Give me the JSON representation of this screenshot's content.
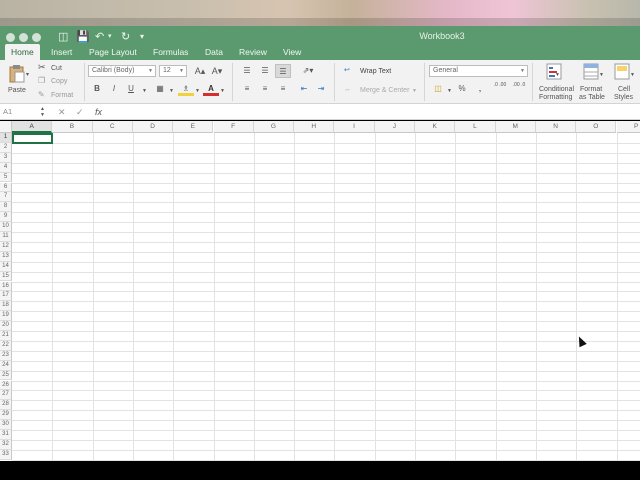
{
  "window": {
    "title": "Workbook3"
  },
  "tabs": [
    {
      "label": "Home",
      "active": true
    },
    {
      "label": "Insert"
    },
    {
      "label": "Page Layout"
    },
    {
      "label": "Formulas"
    },
    {
      "label": "Data"
    },
    {
      "label": "Review"
    },
    {
      "label": "View"
    }
  ],
  "ribbon": {
    "paste_label": "Paste",
    "cut_label": "Cut",
    "copy_label": "Copy",
    "format_label": "Format",
    "font_name": "Calibri (Body)",
    "font_size": "12",
    "bold": "B",
    "italic": "I",
    "underline": "U",
    "wrap_text": "Wrap Text",
    "merge_center": "Merge & Center",
    "number_format": "General",
    "percent": "%",
    "comma": "‚",
    "increase_decimal": ".0 .00",
    "decrease_decimal": ".00 .0",
    "conditional_formatting": [
      "Conditional",
      "Formatting"
    ],
    "format_as_table": [
      "Format",
      "as Table"
    ],
    "cell_styles": [
      "Cell",
      "Styles"
    ]
  },
  "formula_bar": {
    "name_box": "A1",
    "fx": "fx"
  },
  "grid": {
    "columns": [
      "A",
      "B",
      "C",
      "D",
      "E",
      "F",
      "G",
      "H",
      "I",
      "J",
      "K",
      "L",
      "M",
      "N",
      "O",
      "P"
    ],
    "rows": [
      "1",
      "2",
      "3",
      "4",
      "5",
      "6",
      "7",
      "8",
      "9",
      "10",
      "11",
      "12",
      "13",
      "14",
      "15",
      "16",
      "17",
      "18",
      "19",
      "20",
      "21",
      "22",
      "23",
      "24",
      "25",
      "26",
      "27",
      "28",
      "29",
      "30",
      "31",
      "32",
      "33"
    ],
    "active_cell": "A1"
  },
  "colors": {
    "accent": "#5b9a6e",
    "selection": "#217346"
  },
  "icons": [
    "new-sheet-icon",
    "save-icon",
    "undo-icon",
    "redo-icon",
    "customize-icon",
    "paste-icon",
    "cut-icon",
    "copy-icon",
    "format-painter-icon",
    "increase-font-icon",
    "decrease-font-icon",
    "borders-icon",
    "fill-color-icon",
    "font-color-icon",
    "align-top-icon",
    "align-middle-icon",
    "align-bottom-icon",
    "orientation-icon",
    "align-left-icon",
    "align-center-icon",
    "align-right-icon",
    "decrease-indent-icon",
    "increase-indent-icon",
    "wrap-text-icon",
    "merge-icon",
    "accounting-icon",
    "name-box-dropdown-icon",
    "cancel-icon",
    "enter-icon",
    "mouse-cursor-icon"
  ]
}
